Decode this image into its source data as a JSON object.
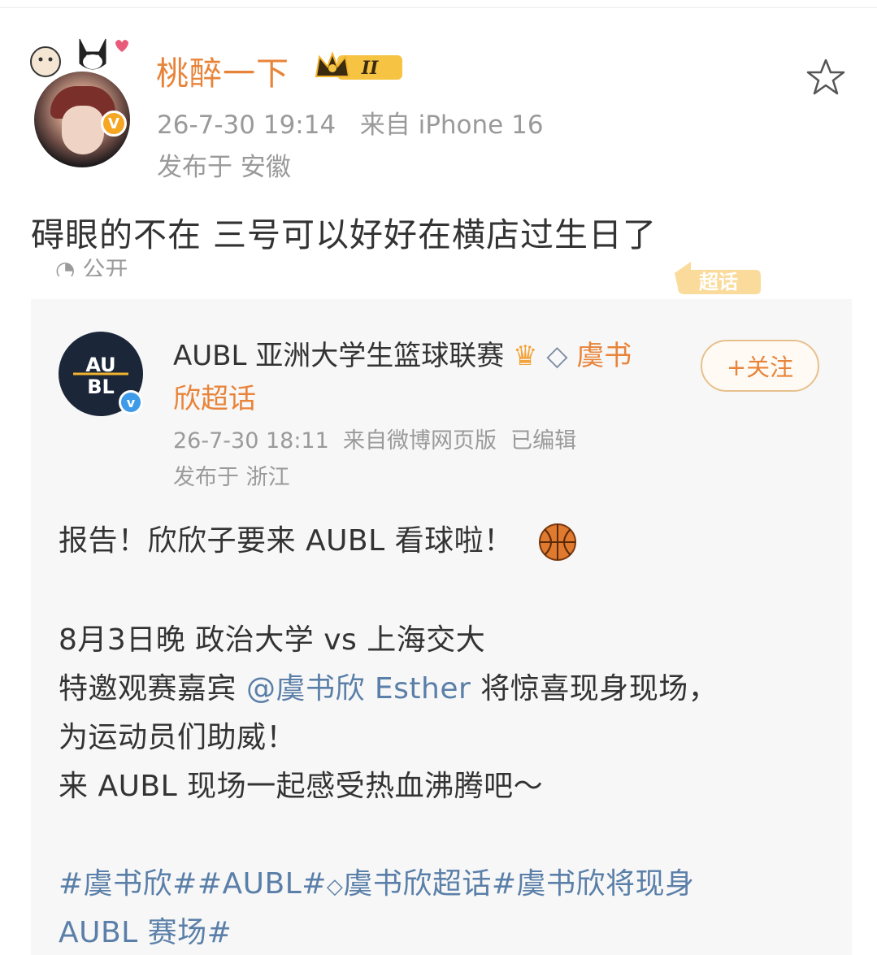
{
  "post": {
    "username": "桃醉一下",
    "level_badge": "II",
    "timestamp": "26-7-30 19:14",
    "source": "来自 iPhone 16",
    "location": "发布于 安徽",
    "content": "碍眼的不在  三号可以好好在横店过生日了",
    "visibility": "公开",
    "super_topic_badge": "超话"
  },
  "repost": {
    "name_main": "AUBL 亚洲大学生篮球联赛",
    "name_topic_1": "虞书",
    "name_topic_2": "欣超话",
    "follow_label": "+关注",
    "timestamp": "26-7-30 18:11",
    "source": "来自微博网页版",
    "edited": "已编辑",
    "location": "发布于 浙江",
    "line1": "报告！欣欣子要来 AUBL 看球啦！",
    "line2": "8月3日晚 政治大学 vs 上海交大",
    "line3_pre": "特邀观赛嘉宾 ",
    "line3_mention": "@虞书欣 Esther",
    "line3_post": " 将惊喜现身现场，",
    "line4": "为运动员们助威！",
    "line5": "来 AUBL 现场一起感受热血沸腾吧～",
    "tags_line1_a": "#虞书欣##AUBL#",
    "tags_line1_b": "虞书欣超话#虞书欣将现身",
    "tags_line2": "AUBL 赛场#"
  },
  "colors": {
    "accent": "#e8843a",
    "link": "#5a7fa8",
    "meta": "#9a9a9a"
  }
}
